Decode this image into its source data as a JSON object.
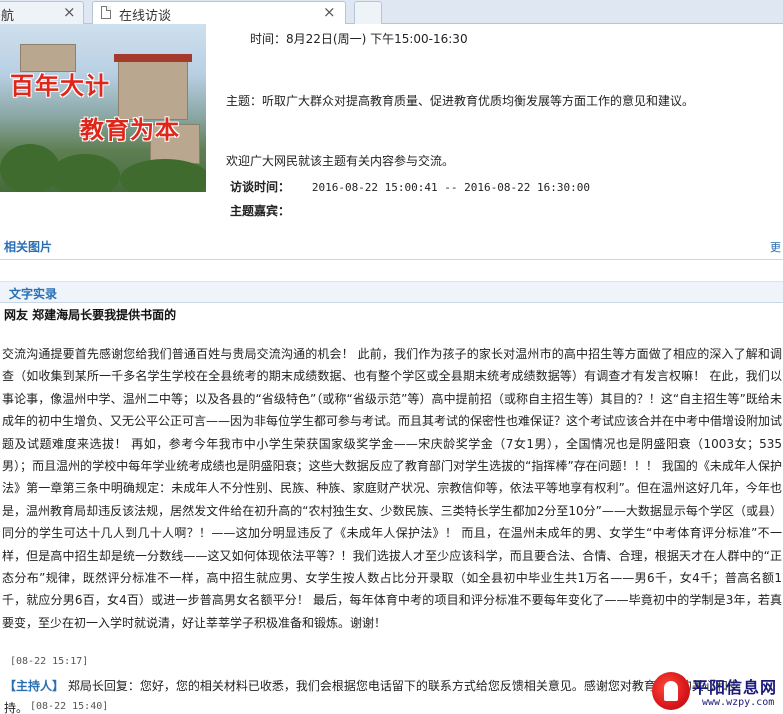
{
  "tabs": [
    {
      "label": "航",
      "close": "×"
    },
    {
      "label": "在线访谈",
      "close": "×"
    },
    {
      "label": ""
    }
  ],
  "banner": {
    "line1": "百年大计",
    "line2": "教育为本"
  },
  "info": {
    "time_line": "时间：8月22日(周一) 下午15:00-16:30",
    "topic_line": "主题：听取广大群众对提高教育质量、促进教育优质均衡发展等方面工作的意见和建议。",
    "welcome_line": "欢迎广大网民就该主题有关内容参与交流。",
    "interview_time_label": "访谈时间：",
    "interview_time_value": "2016-08-22 15:00:41  -- 2016-08-22 16:30:00",
    "guest_label": "主题嘉宾：",
    "guest_value": ""
  },
  "related": {
    "title": "相关图片",
    "more": "更"
  },
  "record": {
    "title": "文字实录"
  },
  "post": {
    "title": "网友  郑建海局长要我提供书面的",
    "body": "交流沟通提要首先感谢您给我们普通百姓与贵局交流沟通的机会！  此前，我们作为孩子的家长对温州市的高中招生等方面做了相应的深入了解和调查（如收集到某所一千多名学生学校在全县统考的期末成绩数据、也有整个学区或全县期末统考成绩数据等）有调查才有发言权嘛！  在此，我们以事论事，像温州中学、温州二中等；以及各县的“省级特色”（或称“省级示范”等）高中提前招（或称自主招生等）其目的？！这“自主招生等”既给未成年的初中生增负、又无公平公正可言——因为非每位学生都可参与考试。而且其考试的保密性也难保证？这个考试应该合并在中考中借增设附加试题及试题难度来选拔！  再如，参考今年我市中小学生荣获国家级奖学金——宋庆龄奖学金（7女1男），全国情况也是阴盛阳衰（1003女；535男）；而且温州的学校中每年学业统考成绩也是阴盛阳衰；这些大数据反应了教育部门对学生选拔的“指挥棒”存在问题！！！  我国的《未成年人保护法》第一章第三条中明确规定：未成年人不分性别、民族、种族、家庭财产状况、宗教信仰等，依法平等地享有权利”。但在温州这好几年，今年也是，温州教育局却违反该法规，居然发文件给在初升高的“农村独生女、少数民族、三类特长学生都加2分至10分”——大数据显示每个学区（或县）同分的学生可达十几人到几十人啊？！——这加分明显违反了《未成年人保护法》！  而且，在温州未成年的男、女学生“中考体育评分标准”不一样，但是高中招生却是统一分数线——这又如何体现依法平等？！我们选拔人才至少应该科学，而且要合法、合情、合理，根据天才在人群中的“正态分布”规律，既然评分标准不一样，高中招生就应男、女学生按人数占比分开录取（如全县初中毕业生共1万名——男6千，女4千；普高名额1千，就应分男6百，女4百）或进一步普高男女名额平分！  最后，每年体育中考的项目和评分标准不要每年变化了——毕竟初中的学制是3年，若真要变，至少在初一入学时就说清，好让莘莘学子积极准备和锻炼。谢谢！"
  },
  "reply": {
    "timestamp": "[08-22 15:17]",
    "host_label": "【主持人】",
    "text": " 郑局长回复：您好，您的相关材料已收悉，我们会根据您电话留下的联系方式给您反馈相关意见。感谢您对教育工作的关心和支",
    "tail": "持。",
    "timestamp2": "[08-22 15:40]"
  },
  "watermark": {
    "name": "平阳信息网",
    "url": "www.wzpy.com"
  }
}
